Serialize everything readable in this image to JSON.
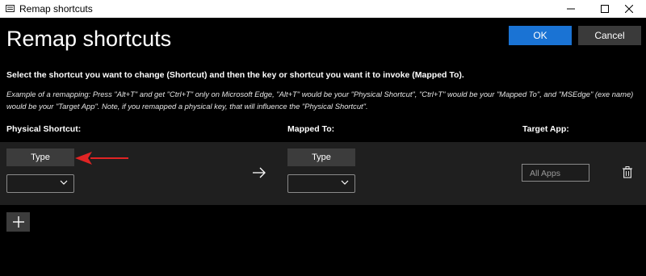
{
  "window": {
    "title": "Remap shortcuts",
    "controls": {
      "minimize": "minimize-icon",
      "maximize": "maximize-icon",
      "close": "close-icon"
    }
  },
  "header": {
    "title": "Remap shortcuts",
    "ok_label": "OK",
    "cancel_label": "Cancel"
  },
  "instruction": "Select the shortcut you want to change (Shortcut) and then the key or shortcut you want it to invoke (Mapped To).",
  "example": "Example of a remapping: Press \"Alt+T\" and get \"Ctrl+T\" only on Microsoft Edge, \"Alt+T\" would be your \"Physical Shortcut\", \"Ctrl+T\" would be your \"Mapped To\", and \"MSEdge\" (exe name) would be your \"Target App\". Note, if you remapped a physical key, that will influence the \"Physical Shortcut\".",
  "columns": {
    "physical": "Physical Shortcut:",
    "mapped": "Mapped To:",
    "target": "Target App:"
  },
  "row": {
    "physical_type_label": "Type",
    "physical_key_value": "",
    "mapped_type_label": "Type",
    "mapped_key_value": "",
    "target_placeholder": "All Apps"
  },
  "colors": {
    "accent": "#1a73d4",
    "annotation_arrow": "#e02424",
    "background": "#000000",
    "row_panel": "#1f1f1f"
  }
}
